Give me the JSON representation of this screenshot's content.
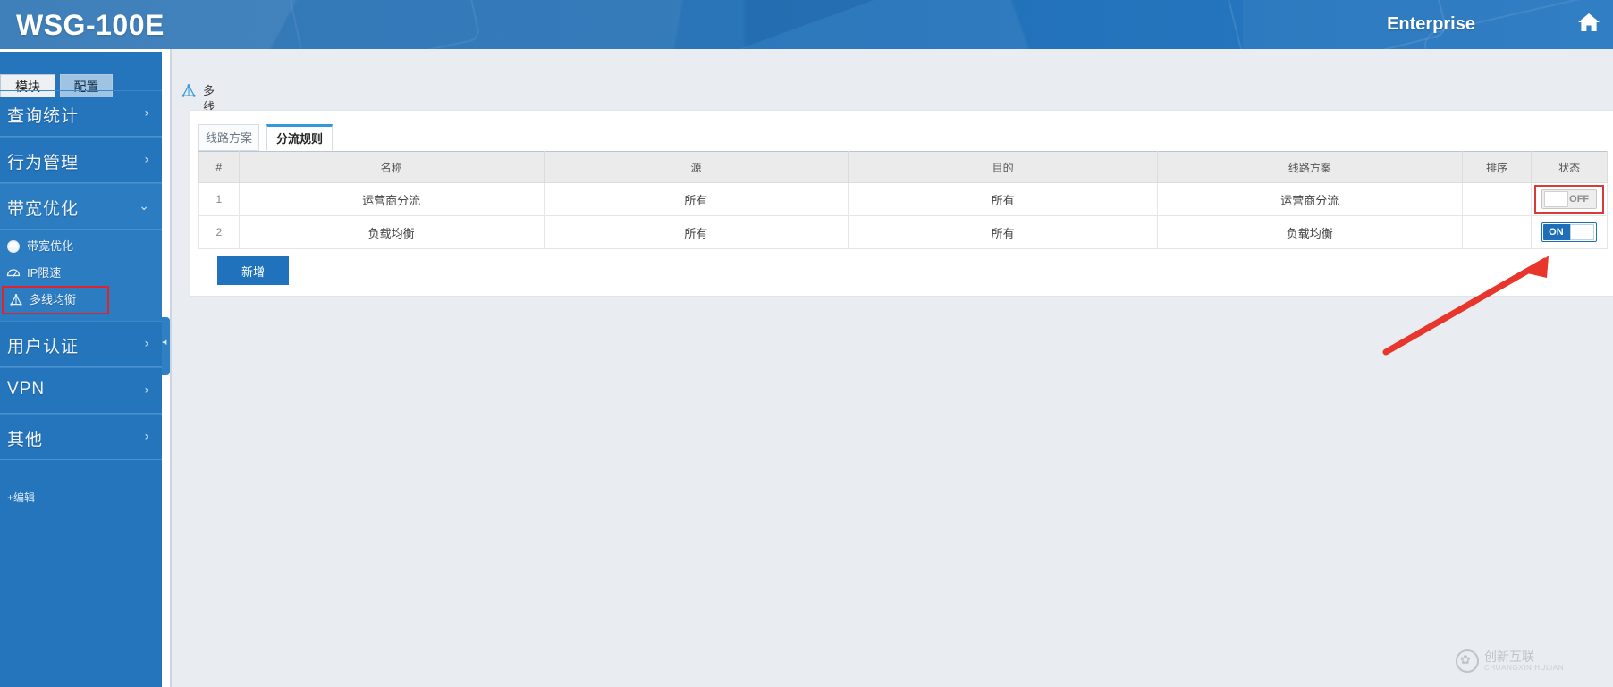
{
  "header": {
    "brand": "WSG-100E",
    "account_label": "Enterprise",
    "home_icon": "home-icon"
  },
  "sidebar": {
    "tabs": [
      {
        "label": "模块",
        "active": true
      },
      {
        "label": "配置",
        "active": false
      }
    ],
    "groups": [
      {
        "label": "查询统计",
        "chevron": "›",
        "expanded": false
      },
      {
        "label": "行为管理",
        "chevron": "›",
        "expanded": false
      },
      {
        "label": "带宽优化",
        "chevron": "⌄",
        "expanded": true
      },
      {
        "label": "用户认证",
        "chevron": "›",
        "expanded": false
      },
      {
        "label": "VPN",
        "chevron": "›",
        "expanded": false
      },
      {
        "label": "其他",
        "chevron": "›",
        "expanded": false
      }
    ],
    "sub_items": [
      {
        "label": "带宽优化",
        "icon": "circle-gauge-icon",
        "highlighted": false
      },
      {
        "label": "IP限速",
        "icon": "speedometer-icon",
        "highlighted": false
      },
      {
        "label": "多线均衡",
        "icon": "multi-line-balance-icon",
        "highlighted": true
      }
    ],
    "edit_link": "+编辑",
    "collapse_handle": "collapse-sidebar-handle"
  },
  "breadcrumb": {
    "icon": "multi-line-balance-icon",
    "text": "多线均衡"
  },
  "panel": {
    "tabs": [
      {
        "label": "线路方案",
        "active": false
      },
      {
        "label": "分流规则",
        "active": true
      }
    ],
    "table": {
      "columns": [
        "#",
        "名称",
        "源",
        "目的",
        "线路方案",
        "排序",
        "状态"
      ],
      "rows": [
        {
          "index": "1",
          "name": "运营商分流",
          "source": "所有",
          "destination": "所有",
          "line_plan": "运营商分流",
          "sort": "",
          "status": "OFF",
          "status_on": false,
          "status_marked": true
        },
        {
          "index": "2",
          "name": "负载均衡",
          "source": "所有",
          "destination": "所有",
          "line_plan": "负载均衡",
          "sort": "",
          "status": "ON",
          "status_on": true,
          "status_marked": false
        }
      ]
    },
    "add_button": "新增"
  },
  "annotation": {
    "arrow": "red-arrow-pointing-to-off-toggle",
    "arrow_color": "#e8362c",
    "highlight_color": "#d93b3b"
  },
  "watermark": {
    "text": "创新互联",
    "subtext": "CHUANGXIN HULIAN",
    "icon": "flower-logo-icon"
  },
  "colors": {
    "brand_blue": "#1b6cb5",
    "sidebar_blue": "#2575bd",
    "accent_blue": "#3498db",
    "button_blue": "#1f72bb",
    "page_bg": "#e9edf1"
  }
}
